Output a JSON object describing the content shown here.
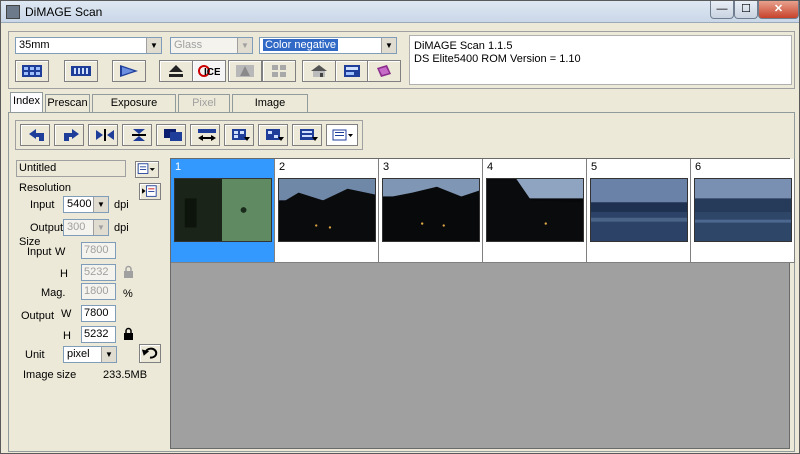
{
  "window": {
    "title": "DiMAGE Scan",
    "close_label": "✕",
    "min_label": "—",
    "max_label": "☐"
  },
  "topbar": {
    "film_format": "35mm",
    "holder": "Glass",
    "film_type": "Color negative",
    "version_line1": "DiMAGE Scan 1.1.5",
    "version_line2": "DS Elite5400 ROM Version = 1.10"
  },
  "tabs": [
    {
      "label": "Index",
      "active": true
    },
    {
      "label": "Prescan",
      "active": false
    },
    {
      "label": "Exposure control",
      "active": false
    },
    {
      "label": "Pixel Polish",
      "disabled": true
    },
    {
      "label": "Image correction",
      "active": false
    }
  ],
  "settings": {
    "job_name": "Untitled",
    "resolution_label": "Resolution",
    "input_label": "Input",
    "input_dpi": "5400",
    "dpi_unit": "dpi",
    "output_label": "Output",
    "output_dpi": "300",
    "size_label": "Size",
    "size_input_label": "Input",
    "w_label": "W",
    "h_label": "H",
    "input_w": "7800",
    "input_h": "5232",
    "mag_label": "Mag.",
    "mag_value": "1800",
    "percent": "%",
    "output_size_label": "Output",
    "output_w": "7800",
    "output_h": "5232",
    "unit_label": "Unit",
    "unit_value": "pixel",
    "image_size_label": "Image size",
    "image_size_value": "233.5MB"
  },
  "frames": [
    {
      "number": "1",
      "selected": true
    },
    {
      "number": "2",
      "selected": false
    },
    {
      "number": "3",
      "selected": false
    },
    {
      "number": "4",
      "selected": false
    },
    {
      "number": "5",
      "selected": false
    },
    {
      "number": "6",
      "selected": false
    }
  ],
  "colors": {
    "selection": "#3399ff",
    "film_area": "#a0a0a0",
    "accent": "#3169c6"
  }
}
